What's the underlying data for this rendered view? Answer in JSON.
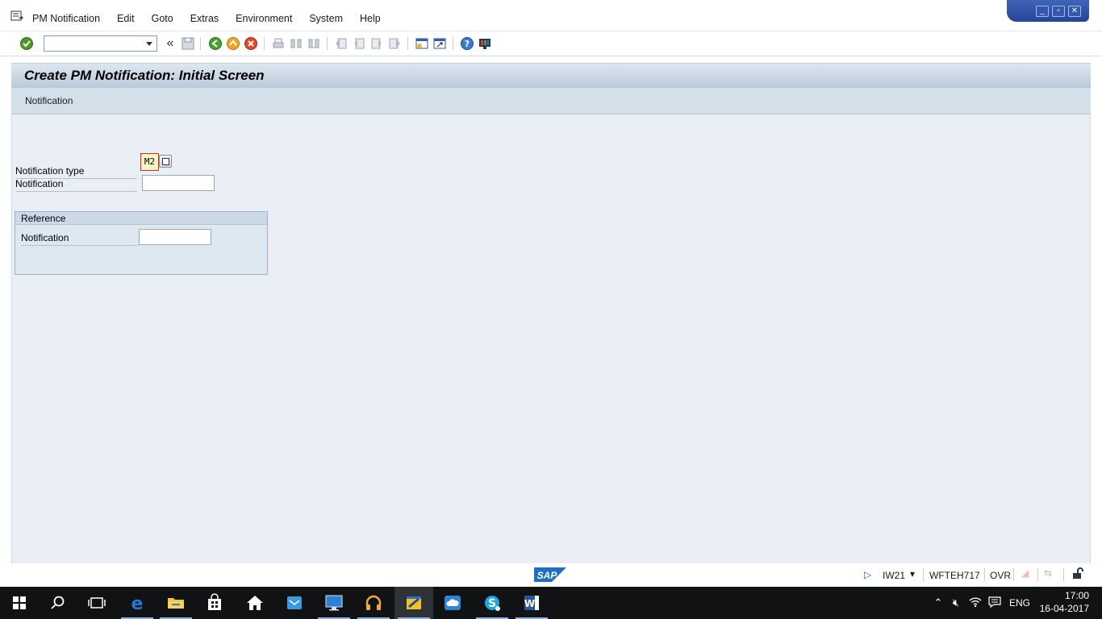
{
  "menu": {
    "items": [
      "PM Notification",
      "Edit",
      "Goto",
      "Extras",
      "Environment",
      "System",
      "Help"
    ]
  },
  "toolbar": {
    "command_value": "",
    "icons": [
      "enter-icon",
      "command-dropdown-icon",
      "back-chevrons-icon",
      "save-icon",
      "back-icon",
      "exit-icon",
      "cancel-icon",
      "print-icon",
      "find-icon",
      "find-next-icon",
      "first-page-icon",
      "previous-page-icon",
      "next-page-icon",
      "last-page-icon",
      "create-session-icon",
      "shortcut-icon",
      "help-icon",
      "customize-layout-icon"
    ]
  },
  "screen": {
    "title": "Create PM Notification: Initial Screen",
    "app_toolbar_button": "Notification"
  },
  "form": {
    "notification_type_label": "Notification type",
    "notification_type_value": "M2",
    "notification_label": "Notification",
    "notification_value": ""
  },
  "reference": {
    "title": "Reference",
    "notification_label": "Notification",
    "notification_value": ""
  },
  "status": {
    "transaction": "IW21",
    "server": "WFTEH717",
    "mode": "OVR",
    "logo_text": "SAP"
  },
  "taskbar": {
    "language": "ENG",
    "time": "17:00",
    "date": "16-04-2017",
    "apps": [
      "start-icon",
      "search-icon",
      "task-view-icon",
      "edge-icon",
      "file-explorer-icon",
      "store-icon",
      "home-icon",
      "mail-icon",
      "desktop-app-icon",
      "headphones-icon",
      "sap-logon-icon",
      "onedrive-icon",
      "skype-icon",
      "word-icon"
    ]
  },
  "colors": {
    "title_gradient_top": "#dce6ef",
    "content_bg": "#e9eff5",
    "required_border": "#d9262a",
    "taskbar_bg": "#101214",
    "window_control_bg": "#2c4ea8"
  }
}
